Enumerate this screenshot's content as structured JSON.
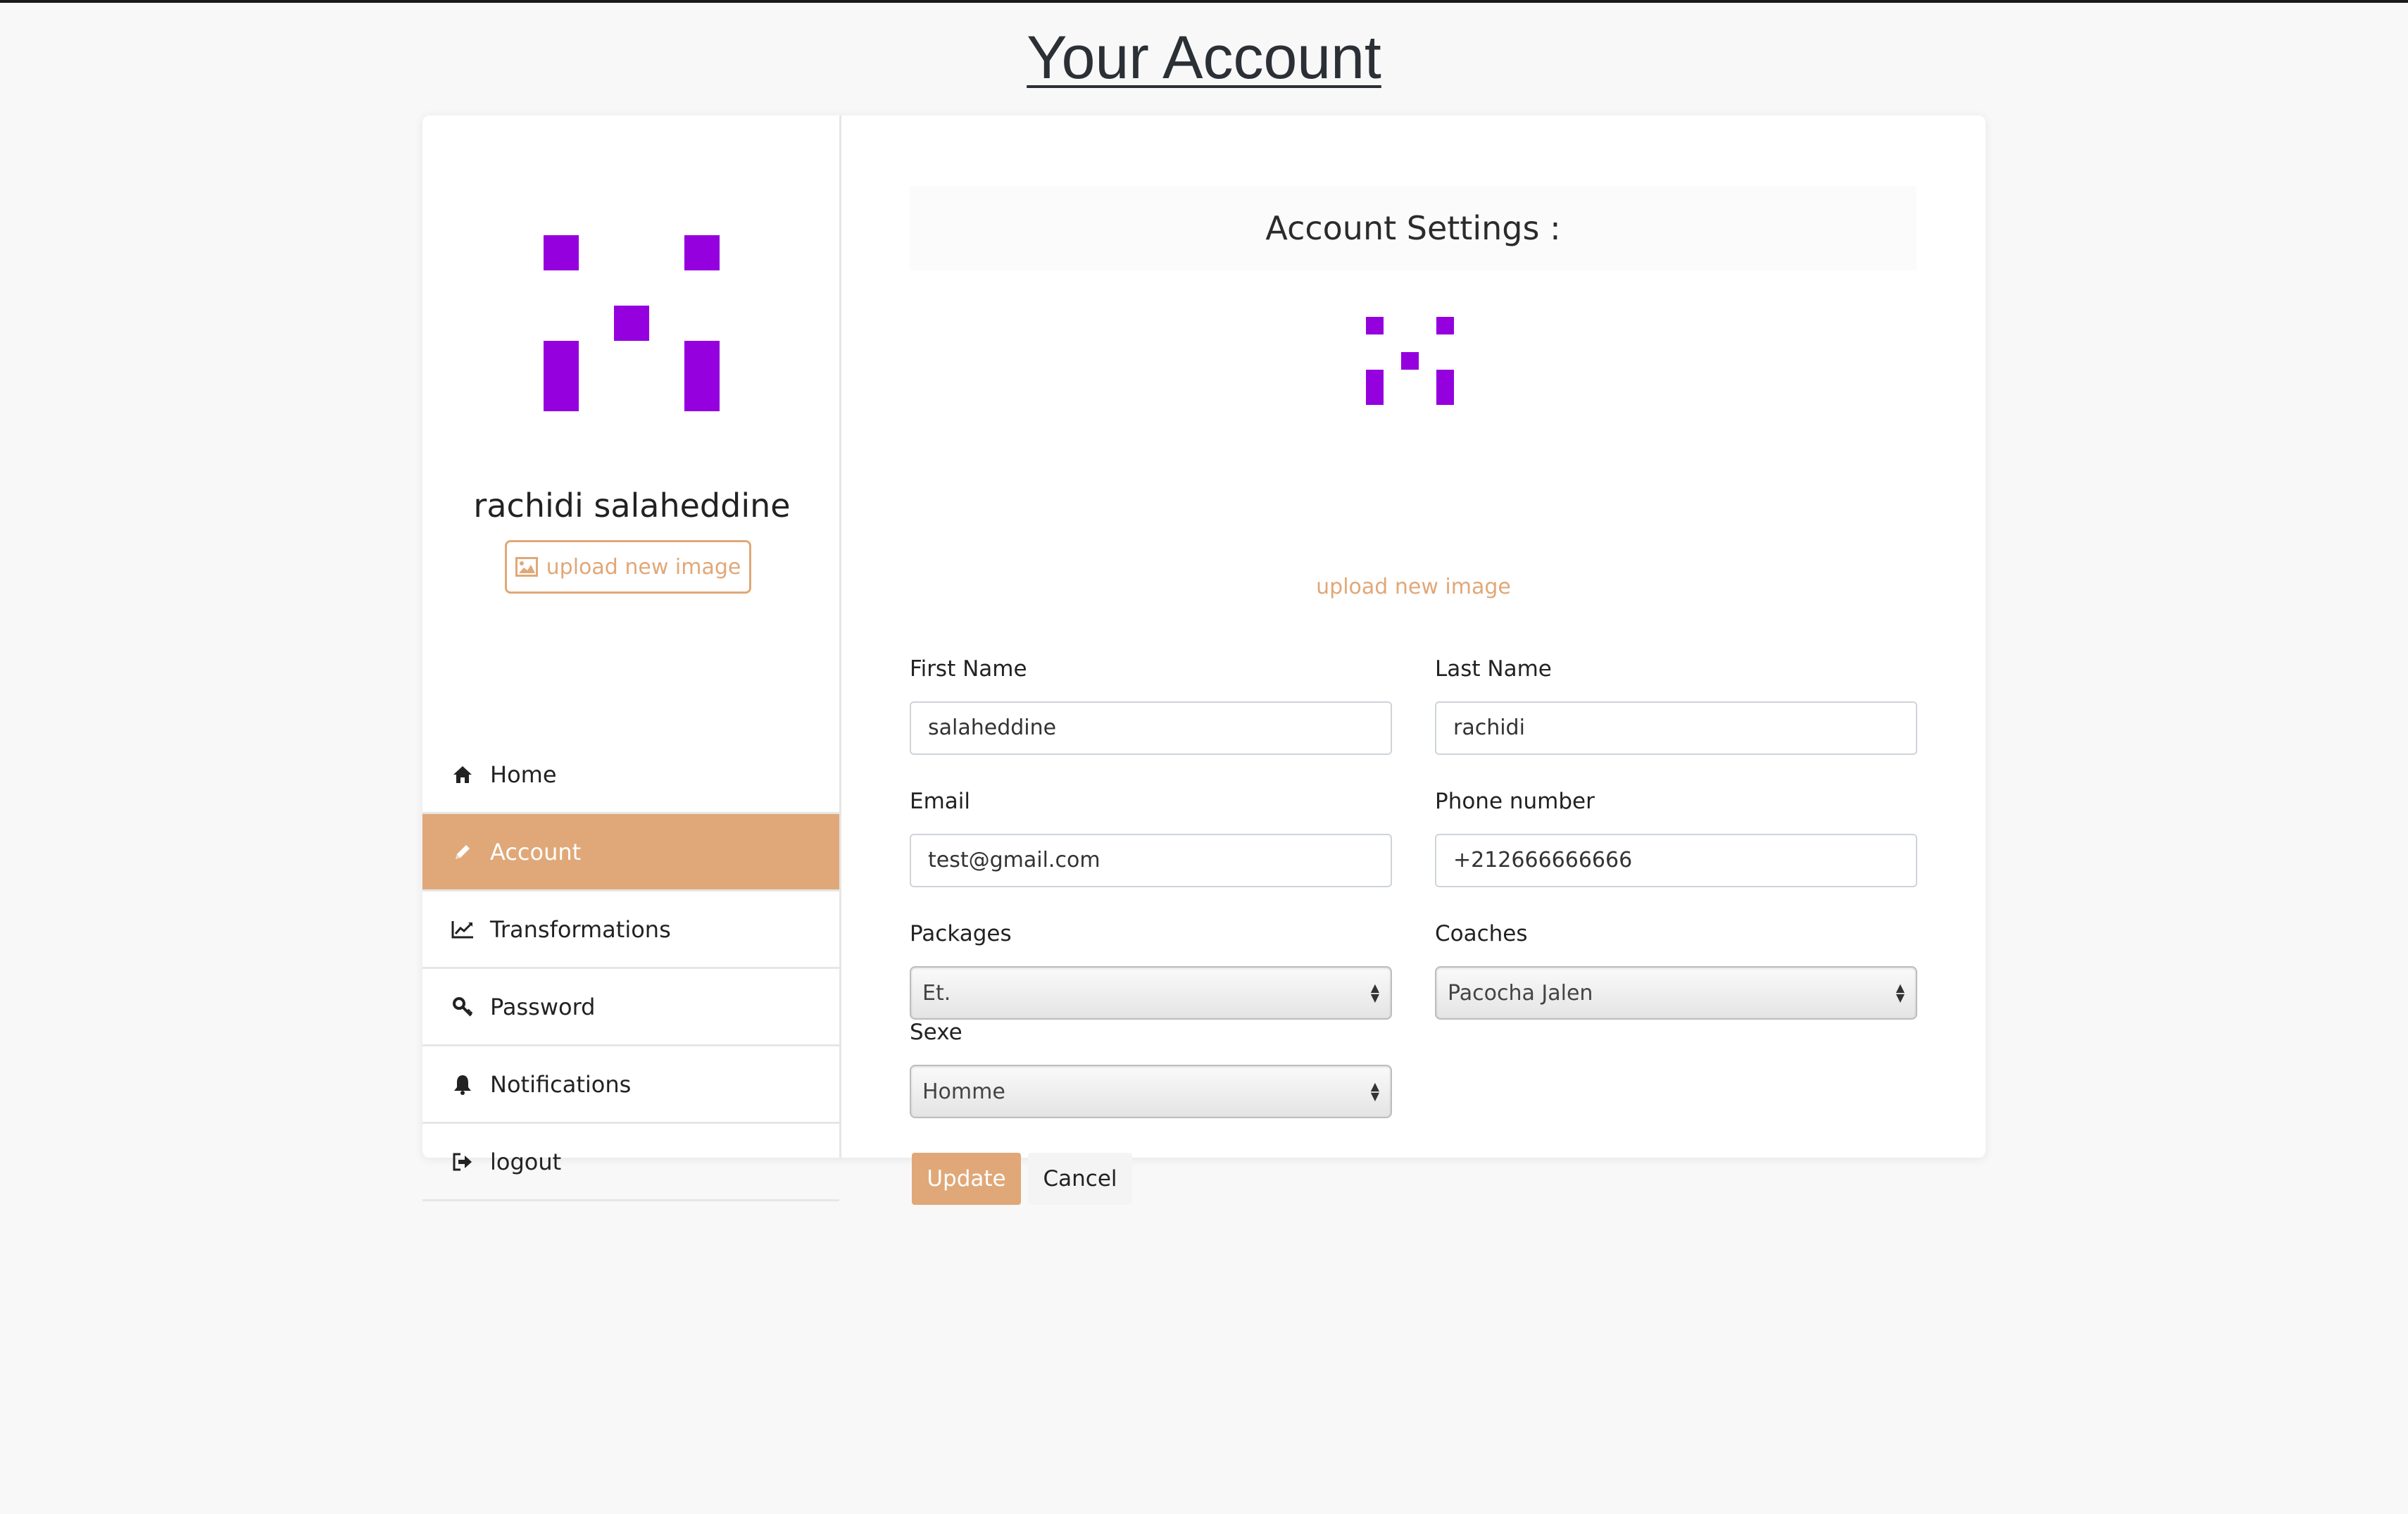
{
  "header": {
    "title": "Your Account"
  },
  "sidebar": {
    "profile_name": "rachidi salaheddine",
    "upload_label": "upload new image",
    "items": [
      {
        "label": "Home",
        "icon": "home-icon",
        "active": false
      },
      {
        "label": "Account",
        "icon": "pencil-icon",
        "active": true
      },
      {
        "label": "Transformations",
        "icon": "line-chart-icon",
        "active": false
      },
      {
        "label": "Password",
        "icon": "key-icon",
        "active": false
      },
      {
        "label": "Notifications",
        "icon": "bell-icon",
        "active": false
      },
      {
        "label": "logout",
        "icon": "sign-out-icon",
        "active": false
      }
    ]
  },
  "main": {
    "section_title": "Account Settings :",
    "upload_link": "upload new image",
    "form": {
      "first_name": {
        "label": "First Name",
        "value": "salaheddine"
      },
      "last_name": {
        "label": "Last Name",
        "value": "rachidi"
      },
      "email": {
        "label": "Email",
        "value": "test@gmail.com"
      },
      "phone": {
        "label": "Phone number",
        "value": "+212666666666"
      },
      "packages": {
        "label": "Packages",
        "value": "Et."
      },
      "coaches": {
        "label": "Coaches",
        "value": "Pacocha Jalen"
      },
      "sexe": {
        "label": "Sexe",
        "value": "Homme"
      }
    },
    "buttons": {
      "update": "Update",
      "cancel": "Cancel"
    }
  },
  "colors": {
    "accent": "#e0a878",
    "avatar": "#9400de",
    "background": "#f8f8f8"
  }
}
